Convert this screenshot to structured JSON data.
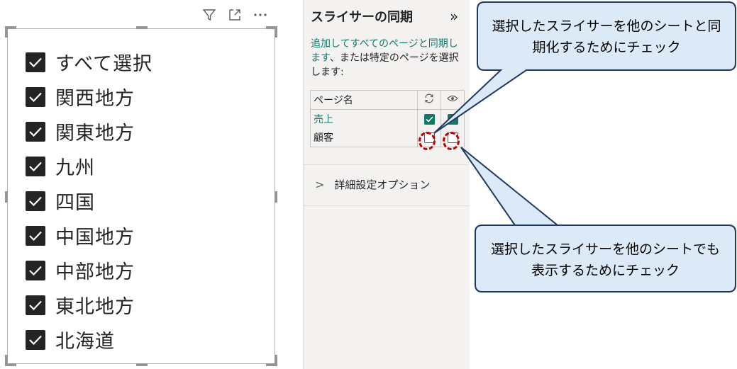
{
  "slicer": {
    "toolbar": [
      {
        "icon": "filter-icon"
      },
      {
        "icon": "focus-mode-icon"
      },
      {
        "icon": "more-options-icon"
      }
    ],
    "items": [
      {
        "label": "すべて選択",
        "checked": true
      },
      {
        "label": "関西地方",
        "checked": true
      },
      {
        "label": "関東地方",
        "checked": true
      },
      {
        "label": "九州",
        "checked": true
      },
      {
        "label": "四国",
        "checked": true
      },
      {
        "label": "中国地方",
        "checked": true
      },
      {
        "label": "中部地方",
        "checked": true
      },
      {
        "label": "東北地方",
        "checked": true
      },
      {
        "label": "北海道",
        "checked": true
      }
    ]
  },
  "sync_panel": {
    "title": "スライサーの同期",
    "collapse_icon": "double-chevron-right-icon",
    "description_link": "追加してすべてのページと同期します",
    "description_rest": "、または特定のページを選択します:",
    "table": {
      "header_page": "ページ名",
      "header_sync_icon": "sync-icon",
      "header_visible_icon": "eye-icon",
      "rows": [
        {
          "page": "売上",
          "sync": true,
          "visible": true,
          "current": true
        },
        {
          "page": "顧客",
          "sync": false,
          "visible": false,
          "current": false
        }
      ]
    },
    "advanced": "詳細設定オプション"
  },
  "callouts": {
    "sync": "選択したスライサーを他のシートと同期化するためにチェック",
    "sync_line1": "選択したスライサーを他のシートと同",
    "sync_line2": "期化するためにチェック",
    "visible_line1": "選択したスライサーを他のシートでも",
    "visible_line2": "表示するためにチェック"
  },
  "colors": {
    "accent": "#117865",
    "highlight": "#c00000",
    "callout_fill": "#dce9f7",
    "callout_border": "#1f3864"
  }
}
